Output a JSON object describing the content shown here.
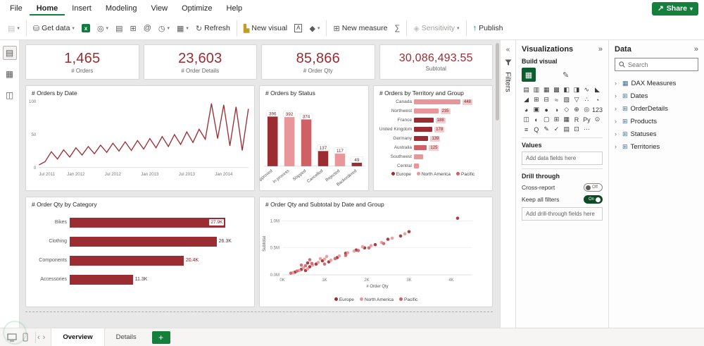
{
  "theme": {
    "dark": "#9b2c31",
    "pink": "#e9969a",
    "mid": "#cf6066",
    "green": "#15803c"
  },
  "menu": {
    "items": [
      "File",
      "Home",
      "Insert",
      "Modeling",
      "View",
      "Optimize",
      "Help"
    ],
    "active": "Home",
    "share_label": "Share"
  },
  "toolbar": {
    "get_data": "Get data",
    "refresh": "Refresh",
    "new_visual": "New visual",
    "new_measure": "New measure",
    "sensitivity": "Sensitivity",
    "publish": "Publish",
    "at_sign": "@",
    "text_box": "A",
    "excel_letter": "x"
  },
  "leftnav": {
    "items": [
      {
        "name": "report-view",
        "glyph": "▤",
        "active": true
      },
      {
        "name": "table-view",
        "glyph": "▦",
        "active": false
      },
      {
        "name": "model-view",
        "glyph": "◫",
        "active": false
      }
    ]
  },
  "canvas": {
    "kpis": [
      {
        "value": "1,465",
        "label": "# Orders"
      },
      {
        "value": "23,603",
        "label": "# Order Details"
      },
      {
        "value": "85,866",
        "label": "# Order Qty"
      },
      {
        "value": "30,086,493.55",
        "label": "Subtotal"
      }
    ]
  },
  "chart_data": [
    {
      "type": "line",
      "title": "# Orders by Date",
      "x_ticks": [
        "Jul 2011",
        "Jan 2012",
        "Jul 2012",
        "Jan 2013",
        "Jul 2013",
        "Jan 2014"
      ],
      "tick_idx": [
        0,
        6,
        12,
        18,
        24,
        30
      ],
      "y_ticks": [
        100,
        50,
        0
      ],
      "ylim": [
        0,
        100
      ],
      "series": [
        {
          "name": "# Orders",
          "values": [
            4,
            9,
            24,
            13,
            27,
            16,
            30,
            19,
            32,
            21,
            34,
            23,
            37,
            25,
            39,
            26,
            41,
            28,
            44,
            30,
            47,
            32,
            50,
            35,
            54,
            38,
            58,
            43,
            97,
            44,
            95,
            33,
            92,
            26,
            89
          ]
        }
      ]
    },
    {
      "type": "bar",
      "title": "# Orders by Status",
      "categories": [
        "Approved",
        "In process",
        "Shipped",
        "Cancelled",
        "Rejected",
        "Backordered"
      ],
      "values": [
        396,
        392,
        374,
        137,
        117,
        49
      ],
      "colors": [
        "dark",
        "pink",
        "mid",
        "dark",
        "pink",
        "dark"
      ],
      "ylim": [
        0,
        430
      ]
    },
    {
      "type": "bar-horizontal-stacked",
      "title": "# Orders by Territory and Group",
      "categories": [
        "Canada",
        "Northwest",
        "France",
        "United Kingdom",
        "Germany",
        "Australia",
        "Southwest",
        "Central"
      ],
      "values": [
        448,
        235,
        188,
        178,
        139,
        125,
        null,
        null
      ],
      "colors": [
        "pink",
        "pink",
        "dark",
        "dark",
        "dark",
        "mid",
        "pink",
        "pink"
      ],
      "legend": [
        "Europe",
        "North America",
        "Pacific"
      ],
      "legend_colors": [
        "dark",
        "pink",
        "mid"
      ],
      "xmax": 448
    },
    {
      "type": "bar-horizontal",
      "title": "# Order Qty by Category",
      "categories": [
        "Bikes",
        "Clothing",
        "Components",
        "Accessories"
      ],
      "values": [
        27900,
        26300,
        20400,
        11300
      ],
      "labels": [
        "27.9K",
        "26.3K",
        "20.4K",
        "11.3K"
      ],
      "label_inside": [
        true,
        false,
        false,
        false
      ],
      "xmax": 30000
    },
    {
      "type": "scatter",
      "title": "# Order Qty and Subtotal by Date and Group",
      "xlabel": "# Order Qty",
      "ylabel": "Subtotal",
      "x_ticks": [
        "0K",
        "1K",
        "2K",
        "3K",
        "4K"
      ],
      "x_tick_vals": [
        0,
        1,
        2,
        3,
        4
      ],
      "y_ticks": [
        "0.0M",
        "0.5M",
        "1.0M"
      ],
      "y_tick_vals": [
        0,
        0.5,
        1.0
      ],
      "xlim": [
        0,
        4.5
      ],
      "ylim": [
        0,
        1.15
      ],
      "legend": [
        "Europe",
        "North America",
        "Pacific"
      ],
      "legend_colors": [
        "dark",
        "pink",
        "mid"
      ],
      "series": [
        {
          "name": "Europe",
          "color": "dark",
          "points": [
            [
              0.3,
              0.05
            ],
            [
              0.45,
              0.1
            ],
            [
              0.55,
              0.08
            ],
            [
              0.65,
              0.15
            ],
            [
              0.8,
              0.2
            ],
            [
              0.95,
              0.26
            ],
            [
              1.1,
              0.24
            ],
            [
              1.3,
              0.32
            ],
            [
              1.5,
              0.4
            ],
            [
              1.75,
              0.46
            ],
            [
              1.95,
              0.5
            ],
            [
              2.2,
              0.56
            ],
            [
              2.5,
              0.66
            ],
            [
              2.8,
              0.72
            ],
            [
              3.0,
              0.8
            ],
            [
              4.15,
              1.05
            ],
            [
              0.6,
              0.22
            ]
          ]
        },
        {
          "name": "North America",
          "color": "pink",
          "points": [
            [
              0.25,
              0.04
            ],
            [
              0.4,
              0.08
            ],
            [
              0.5,
              0.13
            ],
            [
              0.6,
              0.11
            ],
            [
              0.72,
              0.18
            ],
            [
              0.85,
              0.23
            ],
            [
              1.0,
              0.29
            ],
            [
              1.15,
              0.27
            ],
            [
              1.35,
              0.35
            ],
            [
              1.55,
              0.41
            ],
            [
              1.7,
              0.44
            ],
            [
              1.9,
              0.52
            ],
            [
              2.1,
              0.54
            ],
            [
              2.35,
              0.6
            ],
            [
              2.6,
              0.68
            ],
            [
              2.9,
              0.76
            ],
            [
              1.05,
              0.34
            ],
            [
              0.9,
              0.3
            ]
          ]
        },
        {
          "name": "Pacific",
          "color": "mid",
          "points": [
            [
              0.2,
              0.03
            ],
            [
              0.35,
              0.07
            ],
            [
              0.55,
              0.17
            ],
            [
              0.7,
              0.21
            ],
            [
              1.0,
              0.2
            ],
            [
              1.25,
              0.3
            ],
            [
              1.5,
              0.36
            ],
            [
              1.8,
              0.45
            ],
            [
              2.05,
              0.5
            ],
            [
              2.4,
              0.58
            ],
            [
              0.65,
              0.28
            ],
            [
              0.45,
              0.18
            ]
          ]
        }
      ]
    }
  ],
  "filters": {
    "title": "Filters"
  },
  "visualizations": {
    "title": "Visualizations",
    "build_label": "Build visual",
    "selected_glyph": "▦",
    "values_label": "Values",
    "add_fields": "Add data fields here",
    "drill_label": "Drill through",
    "cross_report": "Cross-report",
    "cross_state": "Off",
    "keep_filters": "Keep all filters",
    "keep_state": "On",
    "add_drill": "Add drill-through fields here",
    "icons": [
      {
        "name": "stacked-bar-chart",
        "glyph": "▤"
      },
      {
        "name": "clustered-bar-chart",
        "glyph": "▥"
      },
      {
        "name": "stacked-column-chart",
        "glyph": "▦"
      },
      {
        "name": "clustered-column-chart",
        "glyph": "▩"
      },
      {
        "name": "hundred-stacked-bar",
        "glyph": "◧"
      },
      {
        "name": "hundred-stacked-column",
        "glyph": "◨"
      },
      {
        "name": "line-chart",
        "glyph": "∿"
      },
      {
        "name": "area-chart",
        "glyph": "◣"
      },
      {
        "name": "stacked-area-chart",
        "glyph": "◢"
      },
      {
        "name": "line-clustered-column",
        "glyph": "⊞"
      },
      {
        "name": "line-stacked-column",
        "glyph": "⊟"
      },
      {
        "name": "ribbon-chart",
        "glyph": "≈"
      },
      {
        "name": "waterfall-chart",
        "glyph": "▨"
      },
      {
        "name": "funnel-chart",
        "glyph": "▽"
      },
      {
        "name": "scatter-chart",
        "glyph": "∴"
      },
      {
        "name": "pie-chart",
        "glyph": "◔"
      },
      {
        "name": "donut-chart",
        "glyph": "◕"
      },
      {
        "name": "treemap",
        "glyph": "▣"
      },
      {
        "name": "map",
        "glyph": "●"
      },
      {
        "name": "filled-map",
        "glyph": "◑"
      },
      {
        "name": "shape-map",
        "glyph": "◇"
      },
      {
        "name": "azure-map",
        "glyph": "⊕"
      },
      {
        "name": "gauge",
        "glyph": "◎"
      },
      {
        "name": "card",
        "glyph": "123"
      },
      {
        "name": "multi-row-card",
        "glyph": "◫"
      },
      {
        "name": "kpi",
        "glyph": "◐"
      },
      {
        "name": "slicer",
        "glyph": "▢"
      },
      {
        "name": "table",
        "glyph": "⊞"
      },
      {
        "name": "matrix",
        "glyph": "▦"
      },
      {
        "name": "r-script",
        "glyph": "R"
      },
      {
        "name": "python-visual",
        "glyph": "Py"
      },
      {
        "name": "key-influencers",
        "glyph": "⊙"
      },
      {
        "name": "decomposition-tree",
        "glyph": "≡"
      },
      {
        "name": "qa-visual",
        "glyph": "Q"
      },
      {
        "name": "smart-narrative",
        "glyph": "✎"
      },
      {
        "name": "metrics",
        "glyph": "✓"
      },
      {
        "name": "paginated-report",
        "glyph": "▤"
      },
      {
        "name": "power-apps",
        "glyph": "⊡"
      },
      {
        "name": "more-options",
        "glyph": "⋯"
      }
    ]
  },
  "data_panel": {
    "title": "Data",
    "search_placeholder": "Search",
    "items": [
      {
        "name": "dax-measures",
        "label": "DAX Measures",
        "glyph": "▦"
      },
      {
        "name": "dates",
        "label": "Dates",
        "glyph": "⊞"
      },
      {
        "name": "orderdetails",
        "label": "OrderDetails",
        "glyph": "⊞"
      },
      {
        "name": "products",
        "label": "Products",
        "glyph": "⊞"
      },
      {
        "name": "statuses",
        "label": "Statuses",
        "glyph": "⊞"
      },
      {
        "name": "territories",
        "label": "Territories",
        "glyph": "⊞"
      }
    ]
  },
  "pages": {
    "tabs": [
      "Overview",
      "Details"
    ],
    "active": "Overview"
  }
}
